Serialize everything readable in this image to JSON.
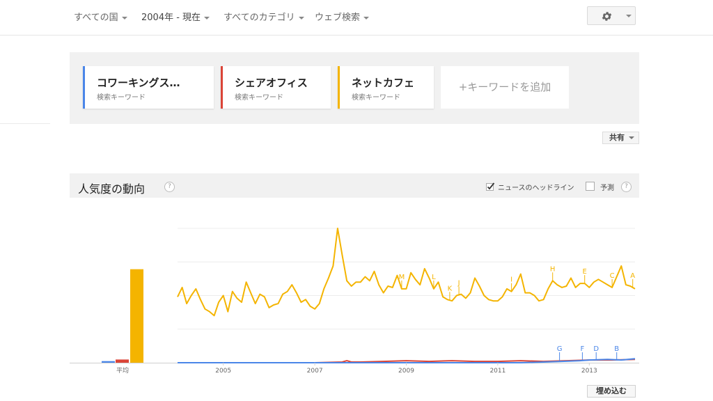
{
  "filters": {
    "country": "すべての国",
    "period": "2004年 - 現在",
    "category": "すべてのカテゴリ",
    "search_type": "ウェブ検索"
  },
  "keywords": [
    {
      "term": "コワーキングス…",
      "sub": "検索キーワード",
      "color": "#4a86e8"
    },
    {
      "term": "シェアオフィス",
      "sub": "検索キーワード",
      "color": "#db4437"
    },
    {
      "term": "ネットカフェ",
      "sub": "検索キーワード",
      "color": "#f4b400"
    }
  ],
  "add_keyword": "+キーワードを追加",
  "share_label": "共有",
  "trend": {
    "title": "人気度の動向",
    "help": "?",
    "news_headlines": "ニュースのヘッドライン",
    "news_checked": true,
    "forecast": "予測",
    "forecast_checked": false
  },
  "embed_label": "埋め込む",
  "chart_data": {
    "type": "line",
    "average_label": "平均",
    "average_bars": [
      {
        "series": "コワーキングス…",
        "value": 1
      },
      {
        "series": "シェアオフィス",
        "value": 2
      },
      {
        "series": "ネットカフェ",
        "value": 58
      }
    ],
    "ylim": [
      0,
      100
    ],
    "x_ticks": [
      "2005",
      "2007",
      "2009",
      "2011",
      "2013"
    ],
    "grid": true,
    "series": [
      {
        "name": "ネットカフェ",
        "color": "#f4b400",
        "x": [
          2004.0,
          2004.1,
          2004.2,
          2004.3,
          2004.4,
          2004.5,
          2004.6,
          2004.7,
          2004.8,
          2004.9,
          2005.0,
          2005.1,
          2005.2,
          2005.3,
          2005.4,
          2005.5,
          2005.6,
          2005.7,
          2005.8,
          2005.9,
          2006.0,
          2006.1,
          2006.2,
          2006.3,
          2006.4,
          2006.5,
          2006.6,
          2006.7,
          2006.8,
          2006.9,
          2007.0,
          2007.1,
          2007.2,
          2007.3,
          2007.4,
          2007.5,
          2007.6,
          2007.7,
          2007.8,
          2007.9,
          2008.0,
          2008.1,
          2008.2,
          2008.3,
          2008.4,
          2008.5,
          2008.6,
          2008.7,
          2008.8,
          2008.9,
          2009.0,
          2009.1,
          2009.2,
          2009.3,
          2009.4,
          2009.5,
          2009.6,
          2009.7,
          2009.8,
          2009.9,
          2010.0,
          2010.1,
          2010.2,
          2010.3,
          2010.4,
          2010.5,
          2010.6,
          2010.7,
          2010.8,
          2010.9,
          2011.0,
          2011.1,
          2011.2,
          2011.3,
          2011.4,
          2011.5,
          2011.6,
          2011.7,
          2011.8,
          2011.9,
          2012.0,
          2012.1,
          2012.2,
          2012.3,
          2012.4,
          2012.5,
          2012.6,
          2012.7,
          2012.8,
          2012.9,
          2013.0,
          2013.1,
          2013.2,
          2013.3,
          2013.4,
          2013.5,
          2013.6,
          2013.7,
          2013.8,
          2013.9,
          2014.0
        ],
        "values": [
          49,
          56,
          44,
          50,
          55,
          47,
          40,
          38,
          35,
          45,
          50,
          38,
          53,
          48,
          45,
          60,
          52,
          44,
          51,
          49,
          41,
          43,
          44,
          51,
          53,
          58,
          52,
          45,
          47,
          42,
          40,
          44,
          55,
          63,
          72,
          100,
          80,
          61,
          57,
          60,
          60,
          64,
          61,
          68,
          58,
          52,
          57,
          56,
          65,
          55,
          55,
          67,
          62,
          58,
          70,
          63,
          55,
          60,
          49,
          47,
          46,
          50,
          51,
          48,
          52,
          63,
          57,
          50,
          47,
          46,
          46,
          49,
          55,
          53,
          58,
          66,
          52,
          52,
          50,
          46,
          47,
          55,
          61,
          58,
          56,
          57,
          63,
          56,
          59,
          59,
          56,
          60,
          62,
          60,
          58,
          56,
          64,
          72,
          58,
          57,
          55
        ]
      },
      {
        "name": "シェアオフィス",
        "color": "#db4437",
        "x": [
          2004.0,
          2005.0,
          2006.0,
          2007.0,
          2007.6,
          2007.7,
          2007.8,
          2008.0,
          2008.5,
          2009.0,
          2009.5,
          2010.0,
          2010.5,
          2011.0,
          2011.5,
          2012.0,
          2012.5,
          2013.0,
          2013.5,
          2014.0
        ],
        "values": [
          0,
          0,
          0,
          0,
          0.5,
          1.5,
          0.5,
          0.5,
          1,
          1.5,
          1,
          1.5,
          1,
          1,
          1.5,
          1,
          1.5,
          2,
          2,
          2.5
        ]
      },
      {
        "name": "コワーキングス…",
        "color": "#4a86e8",
        "x": [
          2004.0,
          2008.0,
          2010.0,
          2011.5,
          2012.0,
          2012.4,
          2012.8,
          2013.0,
          2013.4,
          2013.7,
          2014.0
        ],
        "values": [
          0,
          0,
          0,
          0,
          0.5,
          1,
          1.5,
          2,
          2.5,
          2,
          3
        ]
      }
    ],
    "annotations": [
      {
        "letter": "M",
        "x": 2008.9,
        "color": "#f4b400"
      },
      {
        "letter": "L",
        "x": 2009.6,
        "color": "#f4b400"
      },
      {
        "letter": "K",
        "x": 2009.95,
        "color": "#f4b400"
      },
      {
        "letter": "J",
        "x": 2010.15,
        "color": "#f4b400"
      },
      {
        "letter": "I",
        "x": 2011.3,
        "color": "#f4b400"
      },
      {
        "letter": "H",
        "x": 2012.2,
        "color": "#f4b400"
      },
      {
        "letter": "E",
        "x": 2012.9,
        "color": "#f4b400"
      },
      {
        "letter": "C",
        "x": 2013.5,
        "color": "#f4b400"
      },
      {
        "letter": "A",
        "x": 2013.95,
        "color": "#f4b400"
      },
      {
        "letter": "G",
        "x": 2012.35,
        "color": "#4a86e8"
      },
      {
        "letter": "F",
        "x": 2012.85,
        "color": "#4a86e8"
      },
      {
        "letter": "D",
        "x": 2013.15,
        "color": "#4a86e8"
      },
      {
        "letter": "B",
        "x": 2013.6,
        "color": "#4a86e8"
      }
    ]
  }
}
